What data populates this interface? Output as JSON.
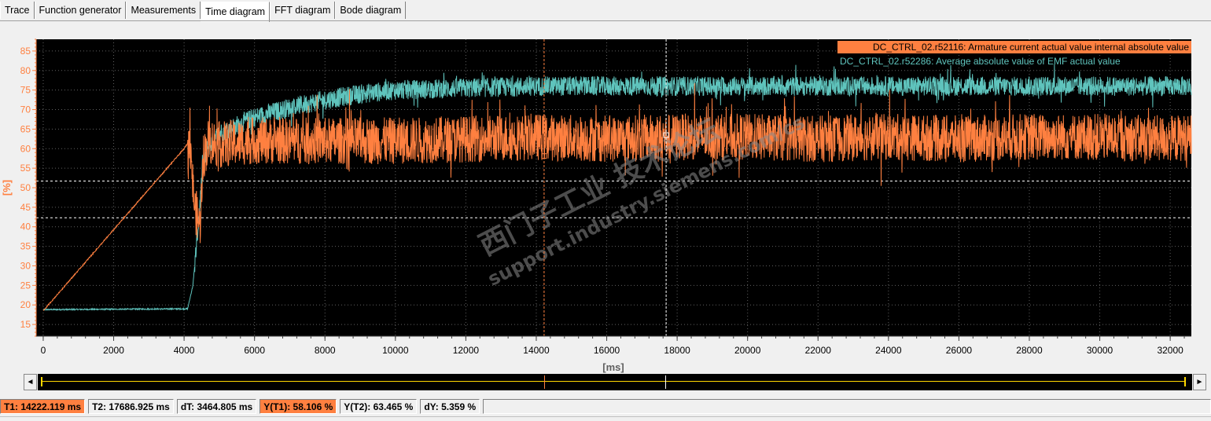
{
  "tabs": [
    {
      "label": "Trace",
      "active": false
    },
    {
      "label": "Function generator",
      "active": false
    },
    {
      "label": "Measurements",
      "active": false
    },
    {
      "label": "Time diagram",
      "active": true
    },
    {
      "label": "FFT diagram",
      "active": false
    },
    {
      "label": "Bode diagram",
      "active": false
    }
  ],
  "colors": {
    "plot_background": "#000000",
    "grid": "#606060",
    "axis_text": "#ff8040",
    "series1": "#ff8040",
    "series2": "#5fc4bd",
    "cursor1": "#ff8040",
    "cursor2": "#ffffff",
    "hline": "#ffffff",
    "watermark": "#8a8a8a"
  },
  "watermark": {
    "line1": "西门子工业 技术论坛",
    "line2": "support.industry.siemens.com/cs"
  },
  "chart_data": {
    "type": "line",
    "xlabel": "[ms]",
    "ylabel": "[%]",
    "xlim": [
      -200,
      32600
    ],
    "ylim": [
      12,
      88
    ],
    "xticks": [
      0,
      2000,
      4000,
      6000,
      8000,
      10000,
      12000,
      14000,
      16000,
      18000,
      20000,
      22000,
      24000,
      26000,
      28000,
      30000,
      32000
    ],
    "yticks": [
      15,
      20,
      25,
      30,
      35,
      40,
      45,
      50,
      55,
      60,
      65,
      70,
      75,
      80,
      85
    ],
    "grid": true,
    "legend_position": "top-right",
    "series": [
      {
        "name": "DC_CTRL_02.r52116: Armature current actual value internal absolute value",
        "color": "#ff8040",
        "x": [
          0,
          4000,
          4150,
          4300,
          4450,
          4550,
          4700,
          5000,
          6000,
          8000,
          10000,
          12000,
          14000,
          16000,
          18000,
          20000,
          22000,
          24000,
          26000,
          28000,
          30000,
          32000,
          32600
        ],
        "values": [
          18.5,
          60,
          62,
          45,
          40,
          58,
          62,
          61,
          62,
          62,
          62,
          62.5,
          63,
          62.5,
          63,
          63,
          62.5,
          63,
          62.5,
          63,
          63,
          62.5,
          63
        ],
        "noise_amplitude": 6
      },
      {
        "name": "DC_CTRL_02.r52286: Average absolute value of EMF actual value",
        "color": "#5fc4bd",
        "x": [
          0,
          4100,
          4250,
          4400,
          4500,
          4650,
          5000,
          6000,
          7000,
          8000,
          9000,
          10000,
          12000,
          14000,
          16000,
          18000,
          20000,
          22000,
          24000,
          26000,
          28000,
          30000,
          32000,
          32600
        ],
        "values": [
          18.8,
          19,
          25,
          40,
          52,
          60,
          64,
          68,
          70.5,
          72.5,
          74,
          75,
          75.5,
          76,
          76,
          76,
          76,
          76,
          76,
          76,
          76,
          76,
          76,
          76
        ],
        "noise_amplitude": 2.5
      }
    ],
    "cursors": {
      "t1": 14222.119,
      "t2": 17686.925,
      "y_t1": 58.106,
      "y_t2": 63.465,
      "hlines": [
        42.3,
        51.7
      ]
    }
  },
  "status": {
    "t1": "T1: 14222.119 ms",
    "t2": "T2: 17686.925 ms",
    "dt": "dT: 3464.805 ms",
    "yt1": "Y(T1):  58.106 %",
    "yt2": "Y(T2): 63.465 %",
    "dy": "dY: 5.359 %"
  },
  "scrollbar": {
    "left_arrow": "◄",
    "right_arrow": "►"
  }
}
